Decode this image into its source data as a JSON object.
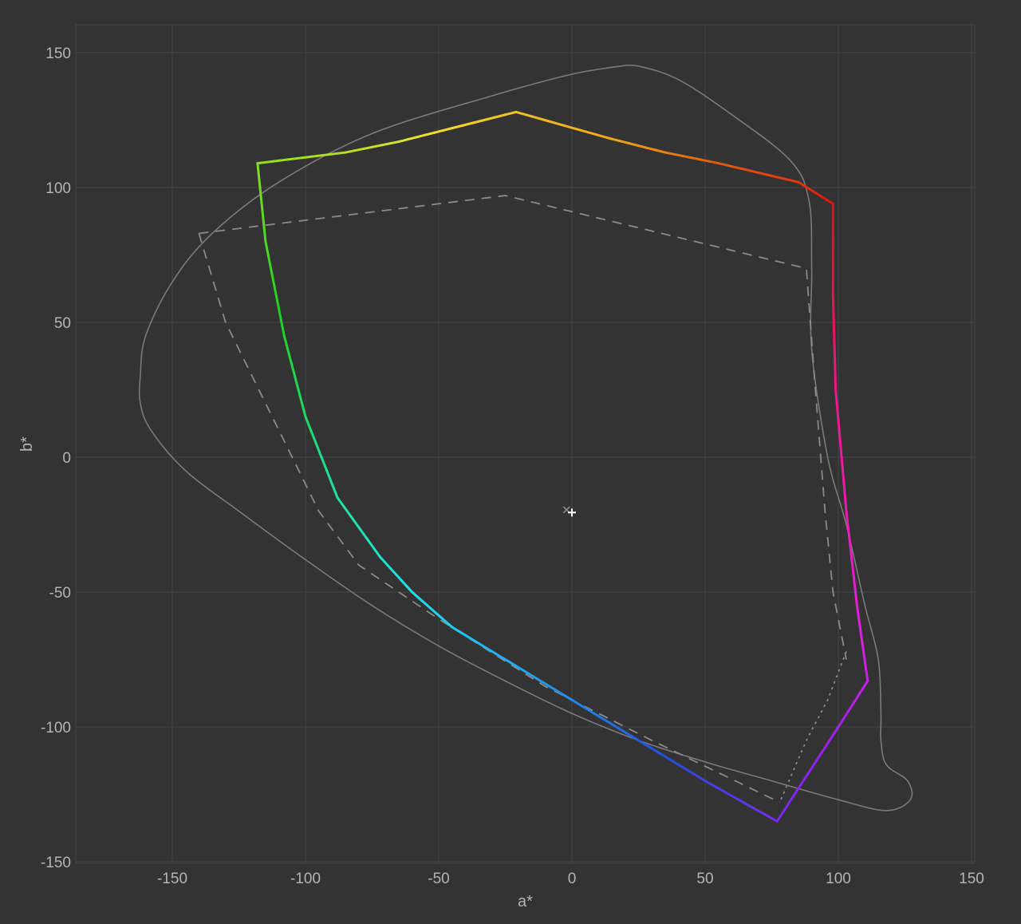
{
  "chart_data": {
    "type": "line",
    "title": "",
    "xlabel": "a*",
    "ylabel": "b*",
    "xlim": [
      -150,
      150
    ],
    "ylim": [
      -150,
      150
    ],
    "x_ticks": [
      -150,
      -100,
      -50,
      0,
      50,
      100,
      150
    ],
    "y_ticks": [
      150,
      100,
      50,
      0,
      -50,
      -100,
      -150
    ],
    "grid": true,
    "background": "#333333",
    "series": [
      {
        "style": "solid-thin",
        "color": "#7a7a7a",
        "points": [
          [
            18,
            145
          ],
          [
            0,
            142
          ],
          [
            -30,
            134
          ],
          [
            -75,
            120
          ],
          [
            -110,
            102
          ],
          [
            -135,
            83
          ],
          [
            -150,
            65
          ],
          [
            -160,
            45
          ],
          [
            -162,
            30
          ],
          [
            -162,
            20
          ],
          [
            -158,
            10
          ],
          [
            -145,
            -5
          ],
          [
            -125,
            -20
          ],
          [
            -100,
            -38
          ],
          [
            -75,
            -55
          ],
          [
            -50,
            -70
          ],
          [
            -25,
            -83
          ],
          [
            0,
            -95
          ],
          [
            25,
            -105
          ],
          [
            50,
            -113
          ],
          [
            75,
            -120
          ],
          [
            100,
            -127
          ],
          [
            118,
            -131
          ],
          [
            127,
            -127
          ],
          [
            126,
            -120
          ],
          [
            118,
            -114
          ],
          [
            116,
            -105
          ],
          [
            116,
            -95
          ],
          [
            115,
            -75
          ],
          [
            110,
            -55
          ],
          [
            103,
            -25
          ],
          [
            96,
            0
          ],
          [
            90,
            40
          ],
          [
            90,
            70
          ],
          [
            89,
            95
          ],
          [
            82,
            110
          ],
          [
            60,
            127
          ],
          [
            40,
            140
          ],
          [
            25,
            145
          ],
          [
            18,
            145
          ]
        ]
      },
      {
        "style": "dashed",
        "color": "#8a8a8a",
        "points": [
          [
            -140,
            83
          ],
          [
            -25,
            97
          ],
          [
            88,
            70
          ],
          [
            91,
            30
          ],
          [
            95,
            -20
          ],
          [
            98,
            -50
          ],
          [
            103,
            -75
          ]
        ]
      },
      {
        "style": "dashed",
        "color": "#8a8a8a",
        "points": [
          [
            -140,
            83
          ],
          [
            -130,
            50
          ],
          [
            -110,
            10
          ],
          [
            -95,
            -20
          ],
          [
            -80,
            -40
          ],
          [
            -50,
            -60
          ],
          [
            -10,
            -85
          ],
          [
            30,
            -105
          ],
          [
            78,
            -128
          ]
        ]
      },
      {
        "style": "dotted",
        "color": "#8a8a8a",
        "points": [
          [
            103,
            -72
          ],
          [
            96,
            -90
          ],
          [
            88,
            -105
          ],
          [
            78,
            -128
          ]
        ]
      },
      {
        "style": "gamut-gradient",
        "colors": [
          "#dd1111",
          "#e06010",
          "#f0b020",
          "#f0e030",
          "#a0e020",
          "#20d020",
          "#20e0a0",
          "#20e0f0",
          "#20a8f0",
          "#2050e0",
          "#9020f0",
          "#e020e0",
          "#f01890",
          "#dd1111"
        ],
        "points": [
          [
            98,
            94
          ],
          [
            85,
            102
          ],
          [
            55,
            109
          ],
          [
            35,
            113
          ],
          [
            15,
            118
          ],
          [
            -21,
            128
          ],
          [
            -45,
            122
          ],
          [
            -65,
            117
          ],
          [
            -85,
            113
          ],
          [
            -118,
            109
          ],
          [
            -115,
            80
          ],
          [
            -108,
            45
          ],
          [
            -100,
            15
          ],
          [
            -88,
            -15
          ],
          [
            -72,
            -37
          ],
          [
            -60,
            -50
          ],
          [
            -45,
            -63
          ],
          [
            -25,
            -75
          ],
          [
            0,
            -90
          ],
          [
            25,
            -105
          ],
          [
            50,
            -120
          ],
          [
            77,
            -135
          ],
          [
            100,
            -100
          ],
          [
            111,
            -83
          ],
          [
            107,
            -55
          ],
          [
            103,
            -20
          ],
          [
            99,
            25
          ],
          [
            98,
            60
          ],
          [
            98,
            94
          ]
        ]
      }
    ],
    "markers": [
      {
        "name": "white-point-cross",
        "x": -2,
        "y": -19.5,
        "symbol": "×",
        "color": "#8a8a8a"
      },
      {
        "name": "white-point-plus",
        "x": 0,
        "y": -20.5,
        "symbol": "+",
        "color": "#ffffff"
      }
    ]
  }
}
